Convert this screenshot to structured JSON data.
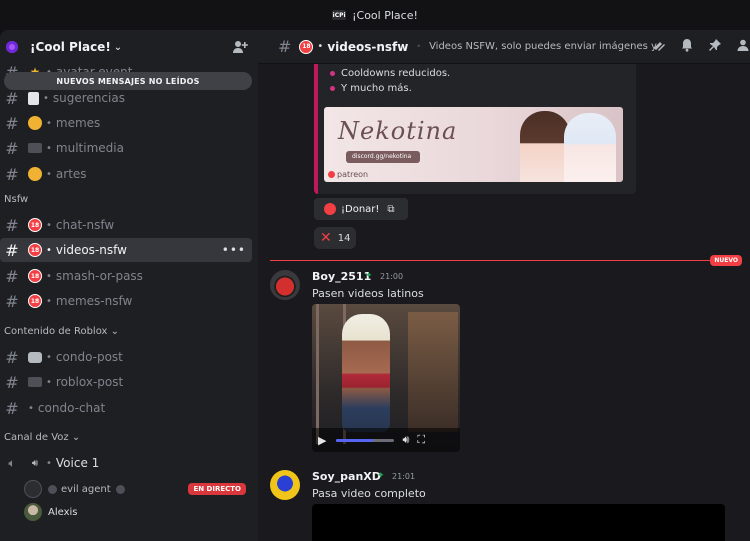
{
  "window": {
    "title": "¡Cool Place!",
    "server_badge": "iCPi"
  },
  "sidebar": {
    "server_name": "¡Cool Place!",
    "unread_banner": "NUEVOS MENSAJES NO LEÍDOS",
    "channels_top": [
      {
        "name": "avatar-event",
        "icon": "star-icon"
      },
      {
        "name": "sugerencias",
        "icon": "document-icon"
      },
      {
        "name": "memes",
        "icon": "face-icon"
      },
      {
        "name": "multimedia",
        "icon": "camera-icon"
      },
      {
        "name": "artes",
        "icon": "palette-icon"
      }
    ],
    "category_nsfw": "Nsfw",
    "channels_nsfw": [
      {
        "name": "chat-nsfw",
        "icon": "age-18-icon"
      },
      {
        "name": "videos-nsfw",
        "icon": "age-18-icon",
        "active": true
      },
      {
        "name": "smash-or-pass",
        "icon": "age-18-icon"
      },
      {
        "name": "memes-nsfw",
        "icon": "age-18-icon"
      }
    ],
    "category_roblox": "Contenido de Roblox",
    "channels_roblox": [
      {
        "name": "condo-post",
        "icon": "cat-icon"
      },
      {
        "name": "roblox-post",
        "icon": "camera-icon"
      },
      {
        "name": "condo-chat",
        "icon": "chat-icon"
      }
    ],
    "category_voice": "Canal de Voz",
    "voice_channel": "Voice 1",
    "voice_users": [
      {
        "name": "evil agent",
        "live": "EN DIRECTO"
      },
      {
        "name": "Alexis"
      }
    ]
  },
  "channel_header": {
    "name": "videos-nsfw",
    "topic": "Videos NSFW, solo puedes enviar imágenes y vid..."
  },
  "embed": {
    "bullets": [
      "Cooldowns reducidos.",
      "Y mucho más."
    ],
    "banner_title": "Nekotina",
    "banner_discord": "discord.gg/nekotina",
    "banner_patreon": "patreon"
  },
  "donate_button": "¡Donar!",
  "reaction": {
    "emoji": "cross-mark",
    "count": "14"
  },
  "new_divider": "NUEVO",
  "messages": [
    {
      "user": "Boy_2511",
      "time": "21:00",
      "text": "Pasen videos latinos",
      "video_progress": 0.63
    },
    {
      "user": "Soy_panXD",
      "time": "21:01",
      "text": "Pasa video completo"
    }
  ],
  "colors": {
    "accent_red": "#f23f43",
    "embed_border": "#c2185b",
    "blurple": "#5865f2",
    "online_green": "#23a55a"
  }
}
